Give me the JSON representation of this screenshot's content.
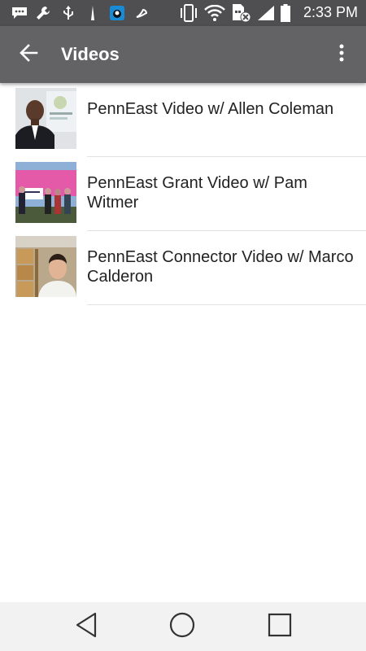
{
  "status_bar": {
    "time": "2:33 PM",
    "icons": [
      "chat-icon",
      "wrench-icon",
      "usb-icon",
      "antenna-icon",
      "app-icon",
      "tool-icon",
      "vibrate-icon",
      "wifi-icon",
      "sim-icon",
      "signal-icon",
      "battery-icon"
    ]
  },
  "app_bar": {
    "title": "Videos",
    "back_icon": "arrow-back-icon",
    "menu_icon": "more-vert-icon"
  },
  "videos": [
    {
      "title": "PennEast Video w/ Allen Coleman"
    },
    {
      "title": "PennEast Grant Video w/ Pam Witmer"
    },
    {
      "title": "PennEast Connector Video w/ Marco Calderon"
    }
  ],
  "nav_bar": {
    "back_icon": "triangle-back-icon",
    "home_icon": "circle-home-icon",
    "recents_icon": "square-recents-icon"
  }
}
